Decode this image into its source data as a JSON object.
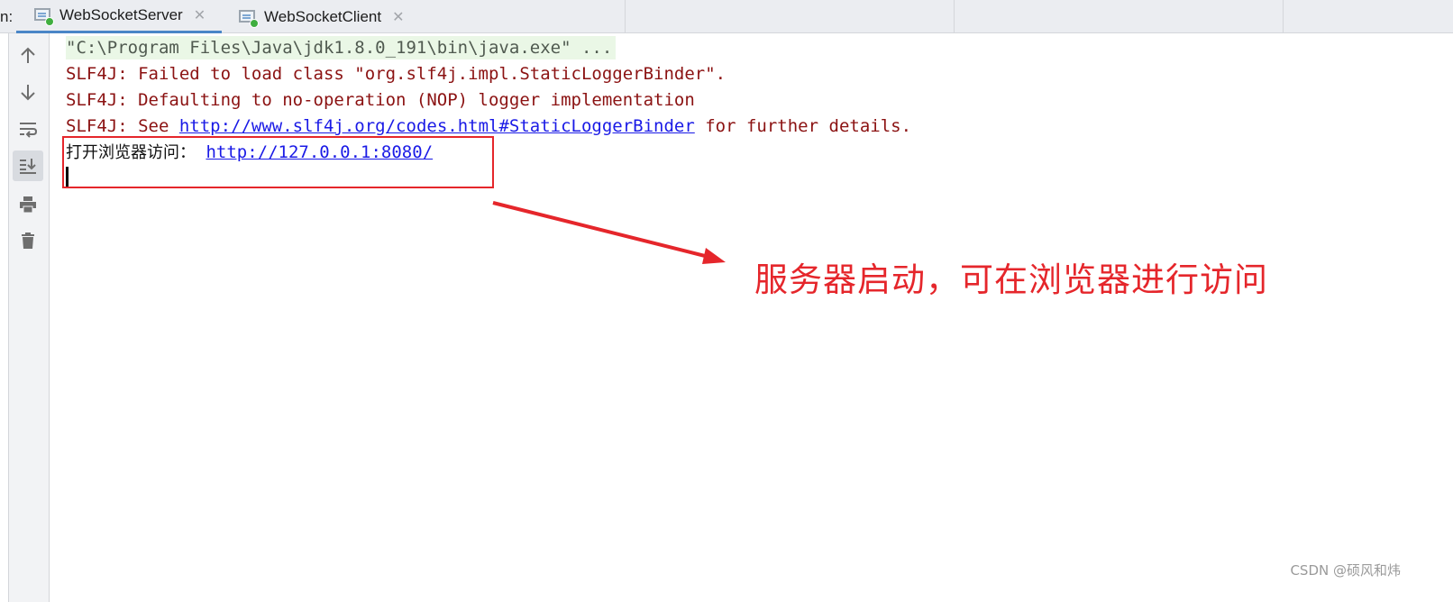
{
  "run_panel": {
    "prefix": "n:",
    "tabs": [
      {
        "label": "WebSocketServer",
        "icon": "run-config-icon",
        "active": true
      },
      {
        "label": "WebSocketClient",
        "icon": "run-config-icon",
        "active": false
      }
    ],
    "close_glyph": "✕"
  },
  "toolbar": {
    "buttons": [
      {
        "icon": "up-arrow-icon",
        "selected": false
      },
      {
        "icon": "down-arrow-icon",
        "selected": false
      },
      {
        "icon": "soft-wrap-icon",
        "selected": false
      },
      {
        "icon": "scroll-to-end-icon",
        "selected": true
      },
      {
        "icon": "print-icon",
        "selected": false
      },
      {
        "icon": "trash-icon",
        "selected": false
      }
    ]
  },
  "console": {
    "command": "\"C:\\Program Files\\Java\\jdk1.8.0_191\\bin\\java.exe\" ...",
    "lines": [
      "SLF4J: Failed to load class \"org.slf4j.impl.StaticLoggerBinder\".",
      "SLF4J: Defaulting to no-operation (NOP) logger implementation"
    ],
    "see_prefix": "SLF4J: See ",
    "see_link": "http://www.slf4j.org/codes.html#StaticLoggerBinder",
    "see_suffix": " for further details.",
    "open_prefix": "打开浏览器访问：",
    "open_link": "http://127.0.0.1:8080/"
  },
  "annotation": {
    "text": "服务器启动，可在浏览器进行访问",
    "color": "#e5262b"
  },
  "watermark": "CSDN @硕风和炜",
  "colors": {
    "error_text": "#8b1212",
    "link": "#1a1ae6",
    "active_tab_underline": "#4a86c7"
  }
}
